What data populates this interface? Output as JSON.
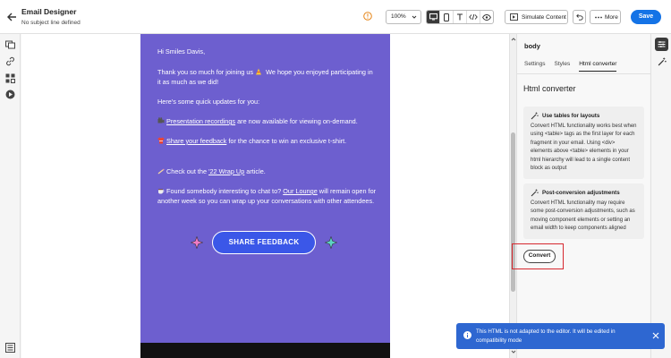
{
  "app": {
    "title": "Email Designer",
    "subtitle": "No subject line defined"
  },
  "toolbar": {
    "zoom": "100%",
    "simulate_label": "Simulate Content",
    "more_label": "More",
    "save_label": "Save"
  },
  "email": {
    "greeting": "Hi Smiles Davis,",
    "intro_before": "Thank you so much for joining us",
    "intro_after": "We hope you enjoyed participating in it as much as we did!",
    "updates_heading": "Here's some quick updates for you:",
    "item1_link": "Presentation recordings",
    "item1_text": " are now available for viewing on-demand.",
    "item2_link": "Share your feedback",
    "item2_text": " for the chance to win an exclusive t-shirt.",
    "item3_prefix": "Check out the ",
    "item3_link": "'22 Wrap Up",
    "item3_suffix": " article.",
    "item4_prefix": "Found somebody interesting to chat to? ",
    "item4_link": "Our Lounge",
    "item4_suffix": " will remain open for another week so you can wrap up your conversations with other attendees.",
    "cta_label": "SHARE FEEDBACK"
  },
  "panel": {
    "heading": "body",
    "tabs": [
      "Settings",
      "Styles",
      "Html converter"
    ],
    "active_tab": "Html converter",
    "section_title": "Html converter",
    "cards": [
      {
        "title": "Use tables for layouts",
        "body": "Convert HTML functionality works best when using <table> tags as the first layer for each fragment in your email. Using <div> elements above <table> elements in your html hierarchy will lead to a single content block as output"
      },
      {
        "title": "Post-conversion adjustments",
        "body": "Convert HTML functionality may require some post-conversion adjustments, such as moving component elements or setting an email width to keep components aligned"
      }
    ],
    "convert_label": "Convert"
  },
  "toast": {
    "message": "This HTML is not adapted to the editor. It will be edited in compatibility mode"
  },
  "colors": {
    "email_bg": "#6d5fcf",
    "cta_bg": "#3b57e8",
    "accent": "#1473e6",
    "toast_bg": "#2e67d1",
    "highlight": "#d6282f"
  }
}
